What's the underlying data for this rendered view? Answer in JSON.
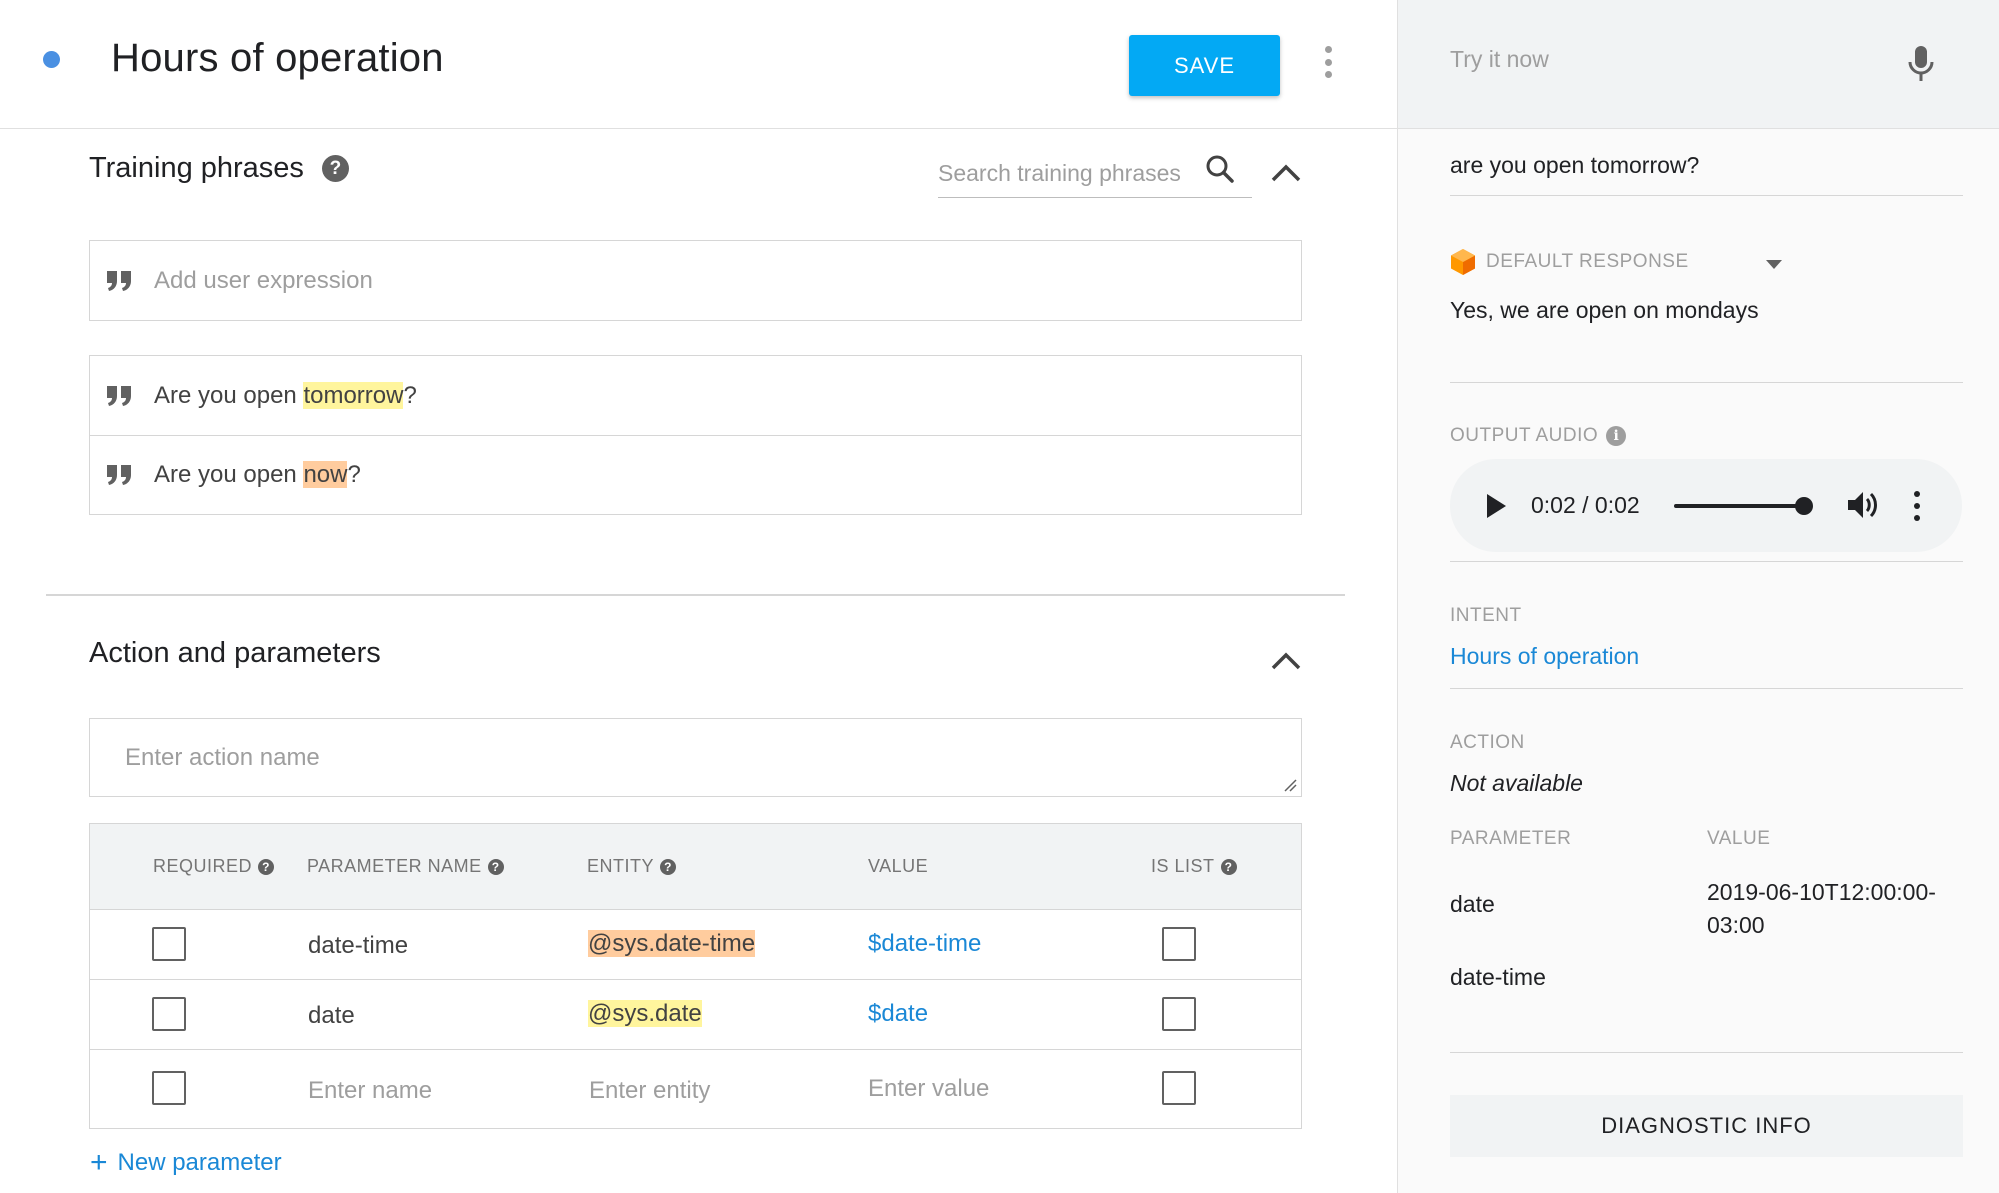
{
  "header": {
    "title": "Hours of operation",
    "save_label": "SAVE"
  },
  "training": {
    "title": "Training phrases",
    "search_placeholder": "Search training phrases",
    "add_placeholder": "Add user expression",
    "phrases": [
      {
        "before": "Are you open ",
        "entity": "tomorrow",
        "after": "?"
      },
      {
        "before": "Are you open ",
        "entity": "now",
        "after": "?"
      }
    ]
  },
  "action": {
    "title": "Action and parameters",
    "action_placeholder": "Enter action name",
    "columns": {
      "required": "REQUIRED",
      "parameter_name": "PARAMETER NAME",
      "entity": "ENTITY",
      "value": "VALUE",
      "is_list": "IS LIST"
    },
    "rows": [
      {
        "name": "date-time",
        "entity": "@sys.date-time",
        "value": "$date-time"
      },
      {
        "name": "date",
        "entity": "@sys.date",
        "value": "$date"
      }
    ],
    "empty_row": {
      "name_placeholder": "Enter name",
      "entity_placeholder": "Enter entity",
      "value_placeholder": "Enter value"
    },
    "new_parameter": "New parameter"
  },
  "side": {
    "try_placeholder": "Try it now",
    "user_query": "are you open tomorrow?",
    "response_label": "DEFAULT RESPONSE",
    "response_text": "Yes, we are open on mondays",
    "output_audio_label": "OUTPUT AUDIO",
    "audio_time": "0:02 / 0:02",
    "intent_label": "INTENT",
    "intent_value": "Hours of operation",
    "action_label": "ACTION",
    "action_value": "Not available",
    "param_col_label": "PARAMETER",
    "value_col_label": "VALUE",
    "params": [
      {
        "name": "date",
        "value": "2019-06-10T12:00:00-03:00"
      },
      {
        "name": "date-time",
        "value": ""
      }
    ],
    "diagnostic_label": "DIAGNOSTIC INFO"
  },
  "colors": {
    "save_button": "#03a9f4",
    "link": "#1a88d6",
    "entity_highlight_yellow": "#fff59d",
    "entity_highlight_orange": "#ffcc9e",
    "status_dot": "#4a90e2"
  }
}
